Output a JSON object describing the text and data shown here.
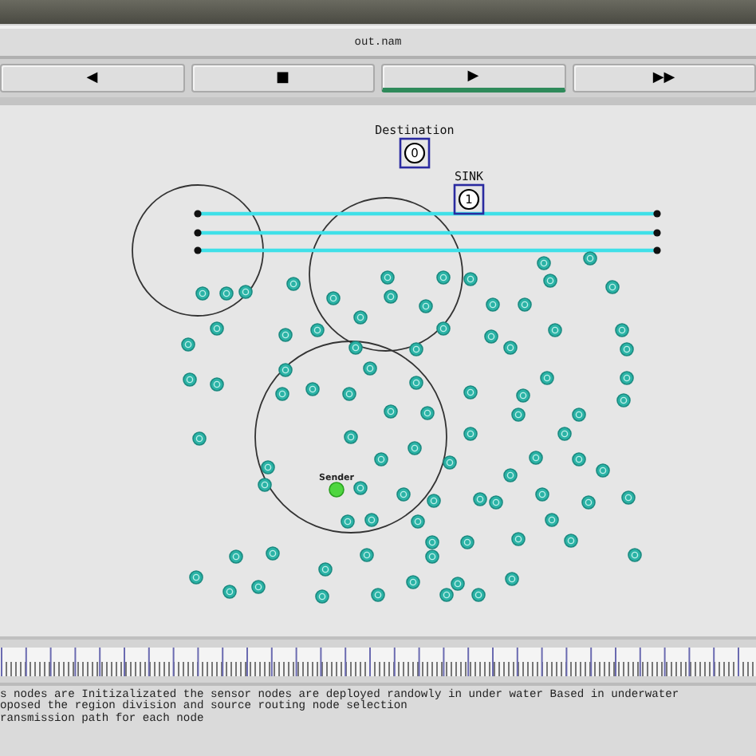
{
  "window": {
    "title": "out.nam"
  },
  "controls": [
    {
      "label": "◀",
      "selected": false
    },
    {
      "label": "■",
      "selected": false
    },
    {
      "label": "▶",
      "selected": true
    },
    {
      "label": "▶▶",
      "selected": false
    }
  ],
  "network": {
    "destination": {
      "label": "Destination",
      "id": "0"
    },
    "sink": {
      "label": "SINK",
      "id": "1"
    },
    "sender": {
      "label": "Sender"
    }
  },
  "log": [
    "s nodes are Initizalizated the sensor nodes are deployed randowly in under water Based in underwater",
    "oposed the region division and source routing node selection",
    "ransmission path for each node"
  ]
}
